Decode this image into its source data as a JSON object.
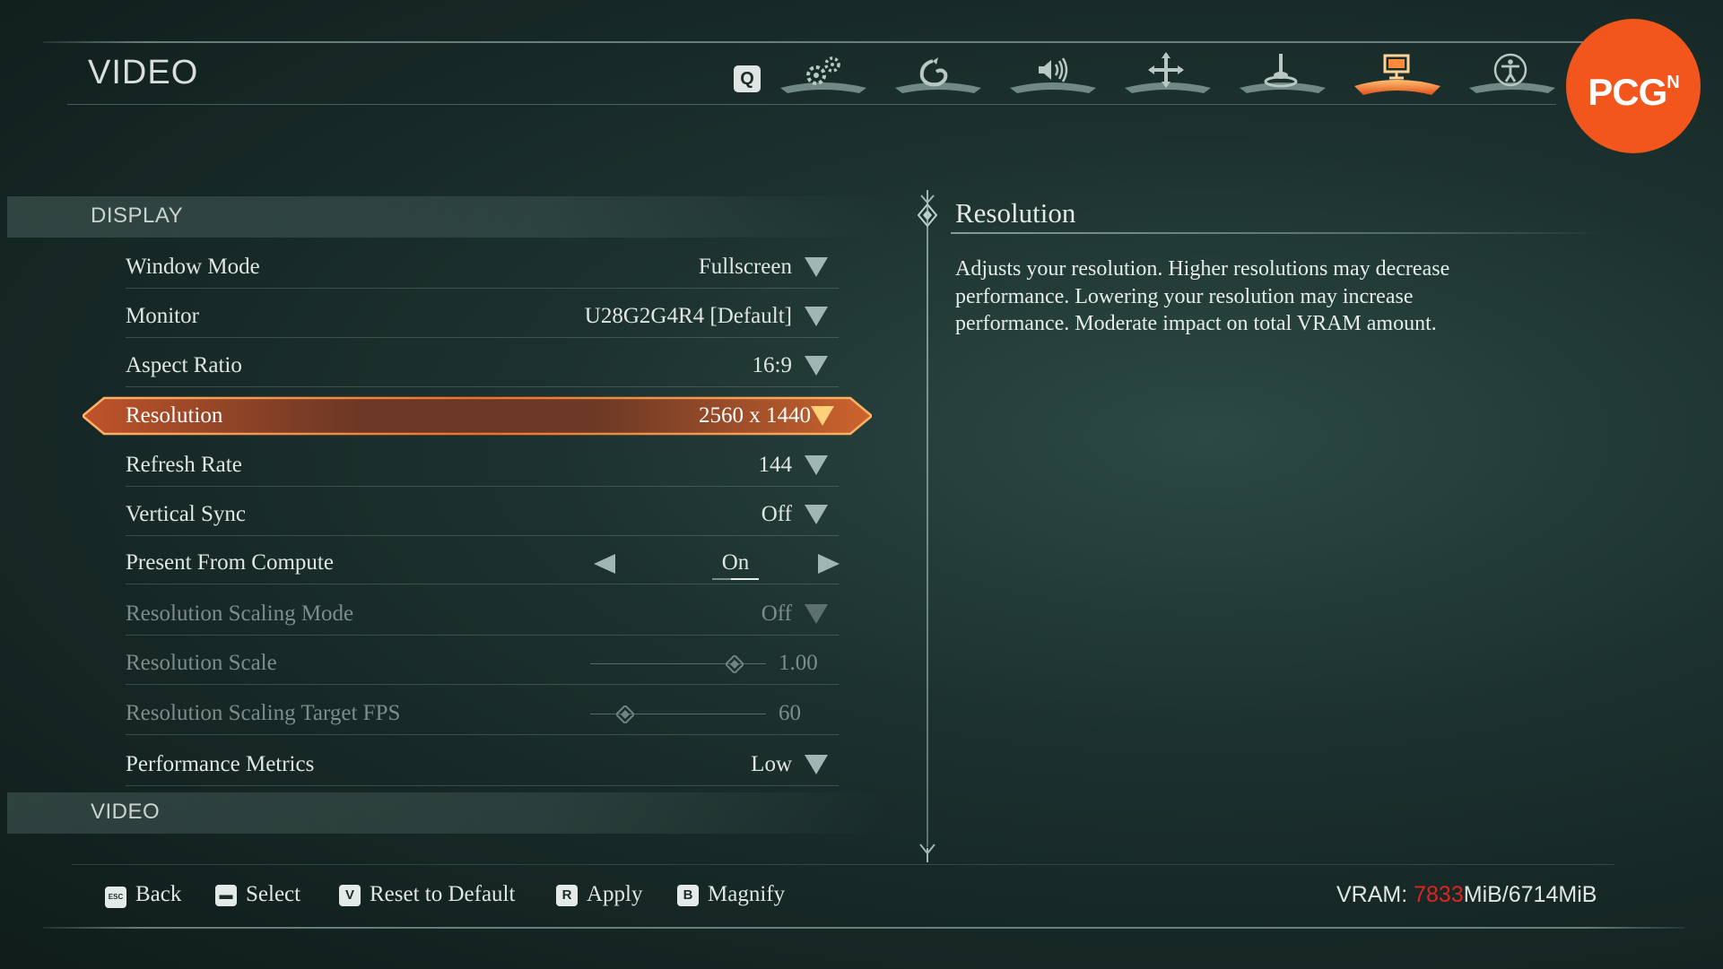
{
  "page_title": "VIDEO",
  "colors": {
    "accent": "#f2561d",
    "selected_glow": "#e8742a",
    "vram_over": "#e0231f"
  },
  "nav": {
    "q_key": "Q",
    "tabs": [
      {
        "icon": "gears-icon",
        "active": false
      },
      {
        "icon": "spiral-icon",
        "active": false
      },
      {
        "icon": "speaker-icon",
        "active": false
      },
      {
        "icon": "move-cross-icon",
        "active": false
      },
      {
        "icon": "joystick-icon",
        "active": false
      },
      {
        "icon": "monitor-icon",
        "active": true
      },
      {
        "icon": "accessibility-icon",
        "active": false
      }
    ]
  },
  "badge": {
    "text": "PCG",
    "sup": "N"
  },
  "sections": {
    "display": "DISPLAY",
    "video": "VIDEO"
  },
  "settings": {
    "window_mode": {
      "label": "Window Mode",
      "value": "Fullscreen"
    },
    "monitor": {
      "label": "Monitor",
      "value": "U28G2G4R4 [Default]"
    },
    "aspect_ratio": {
      "label": "Aspect Ratio",
      "value": "16:9"
    },
    "resolution": {
      "label": "Resolution",
      "value": "2560 x 1440"
    },
    "refresh_rate": {
      "label": "Refresh Rate",
      "value": "144"
    },
    "vertical_sync": {
      "label": "Vertical Sync",
      "value": "Off"
    },
    "present_from_compute": {
      "label": "Present From Compute",
      "value": "On"
    },
    "resolution_scaling_mode": {
      "label": "Resolution Scaling Mode",
      "value": "Off"
    },
    "resolution_scale": {
      "label": "Resolution Scale",
      "value": "1.00",
      "level": 0.82
    },
    "resolution_scaling_target_fps": {
      "label": "Resolution Scaling Target FPS",
      "value": "60",
      "level": 0.2
    },
    "performance_metrics": {
      "label": "Performance Metrics",
      "value": "Low"
    }
  },
  "description": {
    "title": "Resolution",
    "body": "Adjusts your resolution. Higher resolutions may decrease performance. Lowering your resolution may increase performance. Moderate impact on total VRAM amount."
  },
  "footer": {
    "back": {
      "key": "ESC",
      "label": "Back"
    },
    "select": {
      "key": "▬",
      "label": "Select"
    },
    "reset": {
      "key": "V",
      "label": "Reset to Default"
    },
    "apply": {
      "key": "R",
      "label": "Apply"
    },
    "magnify": {
      "key": "B",
      "label": "Magnify"
    },
    "vram": {
      "label": "VRAM: ",
      "used": "7833",
      "rest": "MiB/6714MiB"
    }
  }
}
